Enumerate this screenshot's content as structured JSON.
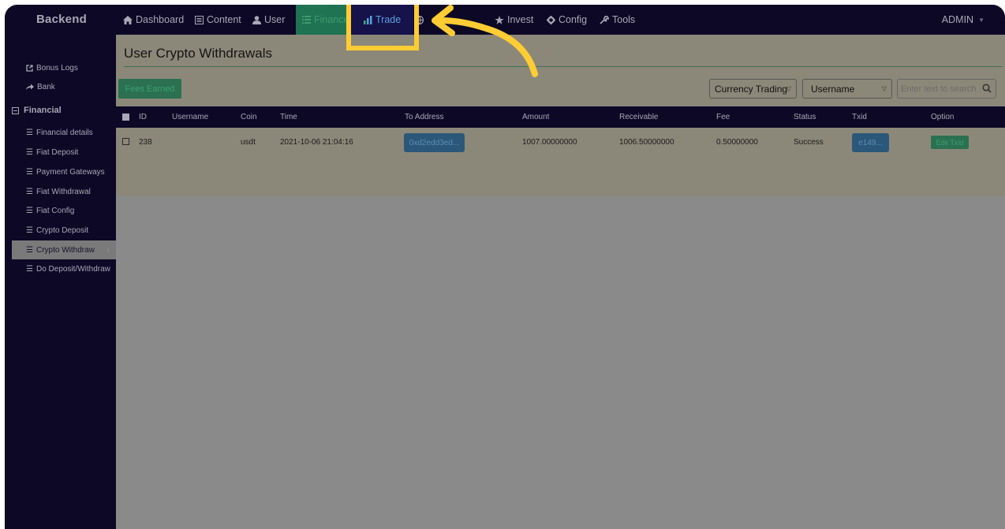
{
  "header": {
    "brand": "Backend",
    "nav": [
      {
        "label": "Dashboard",
        "icon": "home-icon"
      },
      {
        "label": "Content",
        "icon": "document-icon"
      },
      {
        "label": "User",
        "icon": "user-icon"
      },
      {
        "label": "Finance",
        "icon": "list-icon"
      },
      {
        "label": "Trade",
        "icon": "bar-chart-icon"
      },
      {
        "label": "",
        "icon": "globe-icon"
      },
      {
        "label": "Invest",
        "icon": "star-icon"
      },
      {
        "label": "Config",
        "icon": "gear-icon"
      },
      {
        "label": "Tools",
        "icon": "wrench-icon"
      }
    ],
    "admin_label": "ADMIN"
  },
  "sidebar": {
    "items_top": [
      {
        "label": "Bonus Logs",
        "icon": "external-link-icon"
      },
      {
        "label": "Bank",
        "icon": "share-arrow-icon"
      }
    ],
    "section": "Financial",
    "items": [
      {
        "label": "Financial details"
      },
      {
        "label": "Fiat Deposit"
      },
      {
        "label": "Payment Gateways"
      },
      {
        "label": "Fiat Withdrawal"
      },
      {
        "label": "Fiat Config"
      },
      {
        "label": "Crypto Deposit"
      },
      {
        "label": "Crypto Withdraw",
        "active": true
      },
      {
        "label": "Do Deposit/Withdraw"
      }
    ]
  },
  "main": {
    "title": "User Crypto Withdrawals",
    "fees_button": "Fees Earned",
    "filter_type": "Currency Trading",
    "filter_field": "Username",
    "search_placeholder": "Enter text to search"
  },
  "table": {
    "headers": [
      "ID",
      "Username",
      "Coin",
      "Time",
      "To Address",
      "Amount",
      "Receivable",
      "Fee",
      "Status",
      "Txid",
      "Option"
    ],
    "rows": [
      {
        "id": "238",
        "username": "",
        "coin": "usdt",
        "time": "2021-10-06 21:04:16",
        "to_address": "0xd2edd3ed...",
        "amount": "1007.00000000",
        "receivable": "1006.50000000",
        "fee": "0.50000000",
        "status": "Success",
        "txid": "e149...",
        "option": "Edit Txid"
      }
    ]
  },
  "colors": {
    "nav_bg": "#0c0826",
    "highlight": "#ffcc33",
    "finance_green": "#1f7352",
    "link_blue": "#2b5779"
  }
}
